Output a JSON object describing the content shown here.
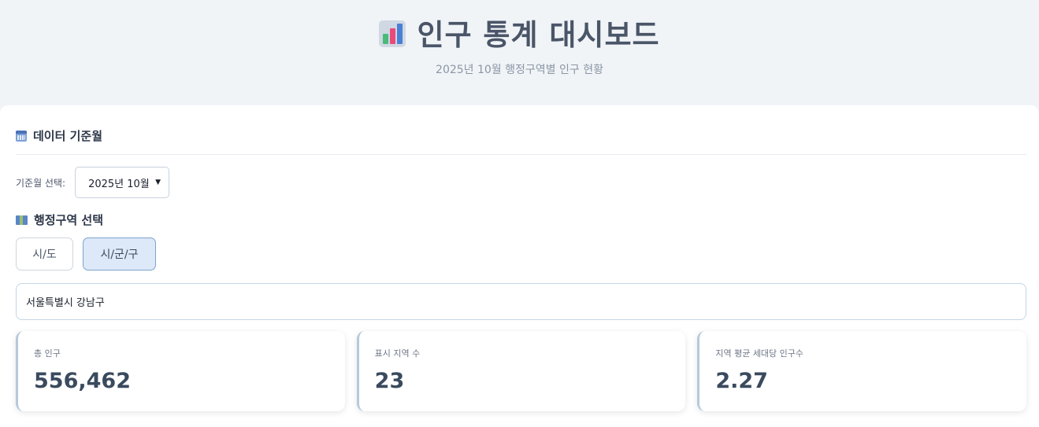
{
  "header": {
    "title": "인구 통계 대시보드",
    "subtitle": "2025년 10월 행정구역별 인구 현황",
    "icon": "bar-chart-icon"
  },
  "data_month": {
    "section_title": "데이터 기준월",
    "label": "기준월 선택:",
    "selected": "2025년 10월",
    "icon": "calendar-icon"
  },
  "region": {
    "section_title": "행정구역 선택",
    "icon": "map-icon",
    "toggles": [
      {
        "label": "시/도",
        "active": false
      },
      {
        "label": "시/군/구",
        "active": true
      }
    ],
    "input_value": "서울특별시 강남구"
  },
  "stats": [
    {
      "label": "총 인구",
      "value": "556,462"
    },
    {
      "label": "표시 지역 수",
      "value": "23"
    },
    {
      "label": "지역 평균 세대당 인구수",
      "value": "2.27"
    }
  ],
  "colors": {
    "background": "#f1f4f7",
    "active_toggle": "#dde9f8",
    "card_accent": "#b7c9db"
  }
}
